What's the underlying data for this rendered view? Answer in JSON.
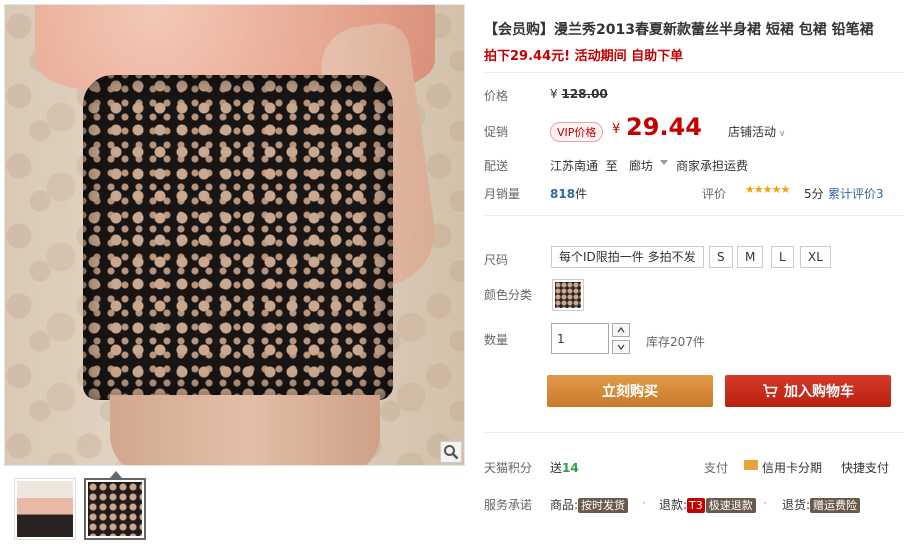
{
  "product": {
    "title": "【会员购】漫兰秀2013春夏新款蕾丝半身裙 短裙 包裙 铅笔裙",
    "subtitle": "拍下29.44元! 活动期间 自助下单"
  },
  "price": {
    "label": "价格",
    "currency": "¥",
    "original": "128.00"
  },
  "promo": {
    "label": "促销",
    "vip_badge": "VIP价格",
    "currency": "¥",
    "price": "29.44",
    "store_activity": "店铺活动"
  },
  "shipping": {
    "label": "配送",
    "from": "江苏南通",
    "to_word": "至",
    "to": "廊坊",
    "fee": "商家承担运费"
  },
  "sales": {
    "label": "月销量",
    "count": "818",
    "unit": "件",
    "rating_label": "评价",
    "stars": "★★★★★",
    "score": "5分",
    "reviews": "累计评价3"
  },
  "size": {
    "label": "尺码",
    "options": [
      "每个ID限拍一件 多拍不发",
      "S",
      "M",
      "L",
      "XL"
    ]
  },
  "color": {
    "label": "颜色分类"
  },
  "quantity": {
    "label": "数量",
    "value": "1",
    "stock": "库存207件"
  },
  "actions": {
    "buy_now": "立刻购买",
    "add_to_cart": "加入购物车"
  },
  "points": {
    "label": "天猫积分",
    "give": "送",
    "amount": "14",
    "pay_label": "支付",
    "card_installment": "信用卡分期",
    "quick_pay": "快捷支付"
  },
  "service": {
    "label": "服务承诺",
    "goods_label": "商品:",
    "goods_tag": "按时发货",
    "refund_label": "退款:",
    "refund_badge": "T3",
    "refund_tag": "极速退款",
    "return_label": "退货:",
    "return_tag": "赠运费险"
  },
  "colors": {
    "accent_red": "#c40000",
    "buy_orange": "#d58a3a",
    "cart_red": "#c8281a",
    "link_blue": "#3567a0"
  }
}
